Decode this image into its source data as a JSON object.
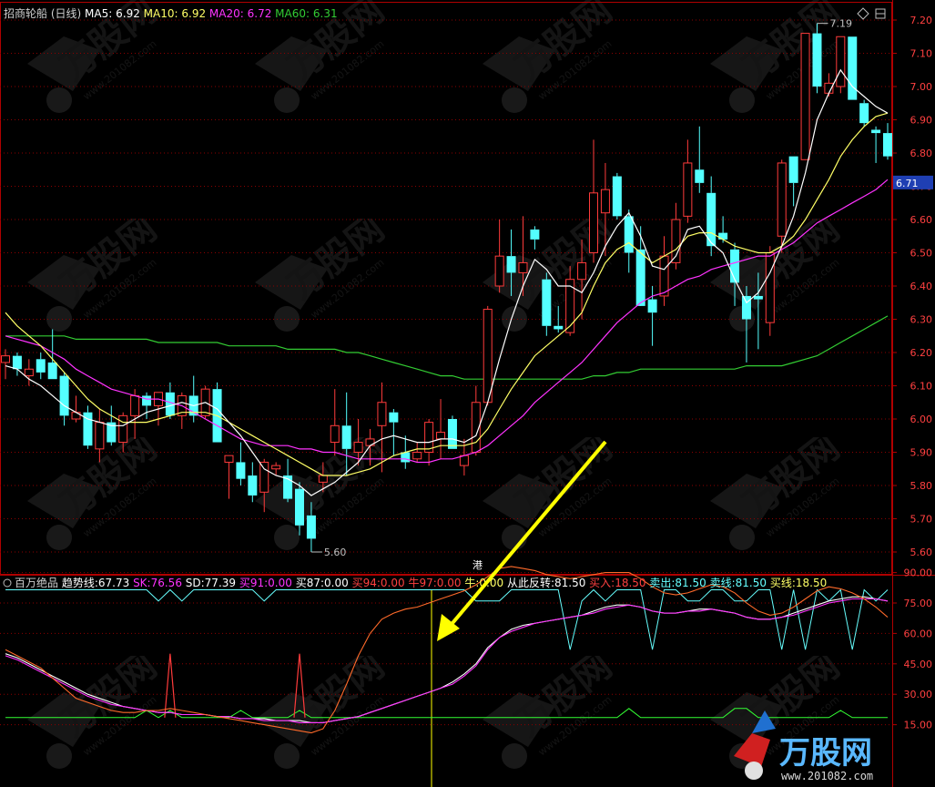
{
  "colors": {
    "bg": "#000000",
    "grid": "#8b0000",
    "frame": "#b00000",
    "up": "#ff3b3b",
    "down": "#54ffff",
    "ma5": "#ffffff",
    "ma10": "#ffff66",
    "ma20": "#ff33ff",
    "ma60": "#33cc33",
    "axis_text": "#ff4040",
    "annotation": "#c0c0c0",
    "arrow": "#ffff00",
    "cursor": "#ffff00",
    "ind_trend": "#ffffff",
    "ind_sk": "#ff33ff",
    "ind_sd": "#ff6a2a",
    "ind_line1": "#66ffff",
    "ind_line2": "#33ff33"
  },
  "header": {
    "stock": "招商轮船",
    "period": "(日线)",
    "ma": [
      {
        "label": "MA5:",
        "value": "6.92",
        "color": "#ffffff"
      },
      {
        "label": "MA10:",
        "value": "6.92",
        "color": "#ffff66"
      },
      {
        "label": "MA20:",
        "value": "6.72",
        "color": "#ff33ff"
      },
      {
        "label": "MA60:",
        "value": "6.31",
        "color": "#33cc33"
      }
    ]
  },
  "price_axis": [
    "7.20",
    "7.10",
    "7.00",
    "6.90",
    "6.80",
    "6.70",
    "6.60",
    "6.50",
    "6.40",
    "6.30",
    "6.20",
    "6.10",
    "6.00",
    "5.90",
    "5.80",
    "5.70",
    "5.60"
  ],
  "current_price_tag": "6.71",
  "annotations": {
    "high": "7.19",
    "low": "5.60",
    "event_marker": "港"
  },
  "indicator": {
    "name": "百万绝品",
    "items": [
      {
        "label": "趋势线:",
        "value": "67.73",
        "color": "#ffffff"
      },
      {
        "label": "SK:",
        "value": "76.56",
        "color": "#ff33ff"
      },
      {
        "label": "SD:",
        "value": "77.39",
        "color": "#ffffff"
      },
      {
        "label": "买91:",
        "value": "0.00",
        "color": "#ff33ff"
      },
      {
        "label": "买87:",
        "value": "0.00",
        "color": "#ffffff"
      },
      {
        "label": "买94:",
        "value": "0.00",
        "color": "#ff4040"
      },
      {
        "label": "牛97:",
        "value": "0.00",
        "color": "#ff4040"
      },
      {
        "label": "牛:",
        "value": "0.00",
        "color": "#ffff66"
      },
      {
        "label": "从此反转:",
        "value": "81.50",
        "color": "#ffffff"
      },
      {
        "label": "买入:",
        "value": "18.50",
        "color": "#ff4040"
      },
      {
        "label": "卖出:",
        "value": "81.50",
        "color": "#66ffff"
      },
      {
        "label": "卖线:",
        "value": "81.50",
        "color": "#66ffff"
      },
      {
        "label": "买线:",
        "value": "18.50",
        "color": "#ffff66"
      }
    ],
    "axis": [
      "90.00",
      "75.00",
      "60.00",
      "45.00",
      "30.00",
      "15.00"
    ]
  },
  "watermark": {
    "logo_text": "万股网",
    "site": "www.201082.com"
  },
  "chart_data": [
    {
      "type": "candlestick",
      "title": "招商轮船 (日线)",
      "ylim": [
        5.55,
        7.24
      ],
      "series_names": [
        "MA5",
        "MA10",
        "MA20",
        "MA60"
      ],
      "candles": [
        {
          "o": 6.17,
          "h": 6.21,
          "l": 6.12,
          "c": 6.19
        },
        {
          "o": 6.19,
          "h": 6.2,
          "l": 6.13,
          "c": 6.15
        },
        {
          "o": 6.13,
          "h": 6.18,
          "l": 6.1,
          "c": 6.15
        },
        {
          "o": 6.18,
          "h": 6.2,
          "l": 6.12,
          "c": 6.14
        },
        {
          "o": 6.17,
          "h": 6.27,
          "l": 6.12,
          "c": 6.12
        },
        {
          "o": 6.13,
          "h": 6.14,
          "l": 5.98,
          "c": 6.01
        },
        {
          "o": 6.0,
          "h": 6.07,
          "l": 5.99,
          "c": 6.02
        },
        {
          "o": 6.02,
          "h": 6.04,
          "l": 5.91,
          "c": 5.92
        },
        {
          "o": 5.91,
          "h": 6.03,
          "l": 5.87,
          "c": 5.99
        },
        {
          "o": 5.99,
          "h": 6.04,
          "l": 5.92,
          "c": 5.93
        },
        {
          "o": 5.93,
          "h": 6.02,
          "l": 5.9,
          "c": 6.01
        },
        {
          "o": 6.01,
          "h": 6.09,
          "l": 5.94,
          "c": 6.07
        },
        {
          "o": 6.07,
          "h": 6.08,
          "l": 6.0,
          "c": 6.04
        },
        {
          "o": 6.04,
          "h": 6.08,
          "l": 5.98,
          "c": 6.08
        },
        {
          "o": 6.08,
          "h": 6.11,
          "l": 6.0,
          "c": 6.01
        },
        {
          "o": 6.01,
          "h": 6.08,
          "l": 5.97,
          "c": 6.07
        },
        {
          "o": 6.07,
          "h": 6.13,
          "l": 5.99,
          "c": 6.01
        },
        {
          "o": 6.01,
          "h": 6.1,
          "l": 6.0,
          "c": 6.09
        },
        {
          "o": 6.09,
          "h": 6.11,
          "l": 5.93,
          "c": 5.93
        },
        {
          "o": 5.87,
          "h": 5.89,
          "l": 5.76,
          "c": 5.89
        },
        {
          "o": 5.87,
          "h": 5.93,
          "l": 5.8,
          "c": 5.82
        },
        {
          "o": 5.83,
          "h": 5.87,
          "l": 5.75,
          "c": 5.77
        },
        {
          "o": 5.78,
          "h": 5.88,
          "l": 5.72,
          "c": 5.87
        },
        {
          "o": 5.85,
          "h": 5.87,
          "l": 5.83,
          "c": 5.86
        },
        {
          "o": 5.83,
          "h": 5.88,
          "l": 5.75,
          "c": 5.76
        },
        {
          "o": 5.79,
          "h": 5.81,
          "l": 5.65,
          "c": 5.68
        },
        {
          "o": 5.71,
          "h": 5.75,
          "l": 5.6,
          "c": 5.64
        },
        {
          "o": 5.81,
          "h": 5.87,
          "l": 5.78,
          "c": 5.83
        },
        {
          "o": 5.93,
          "h": 6.09,
          "l": 5.89,
          "c": 5.98
        },
        {
          "o": 5.98,
          "h": 6.08,
          "l": 5.83,
          "c": 5.91
        },
        {
          "o": 5.9,
          "h": 6.0,
          "l": 5.86,
          "c": 5.93
        },
        {
          "o": 5.92,
          "h": 5.97,
          "l": 5.86,
          "c": 5.94
        },
        {
          "o": 5.98,
          "h": 6.11,
          "l": 5.84,
          "c": 6.05
        },
        {
          "o": 6.02,
          "h": 6.03,
          "l": 5.89,
          "c": 5.99
        },
        {
          "o": 5.9,
          "h": 5.95,
          "l": 5.85,
          "c": 5.87
        },
        {
          "o": 5.88,
          "h": 5.93,
          "l": 5.87,
          "c": 5.9
        },
        {
          "o": 5.9,
          "h": 6.0,
          "l": 5.86,
          "c": 5.99
        },
        {
          "o": 5.94,
          "h": 6.06,
          "l": 5.88,
          "c": 5.96
        },
        {
          "o": 6.0,
          "h": 6.01,
          "l": 5.91,
          "c": 5.91
        },
        {
          "o": 5.86,
          "h": 5.94,
          "l": 5.83,
          "c": 5.89
        },
        {
          "o": 5.9,
          "h": 6.1,
          "l": 5.89,
          "c": 6.05
        },
        {
          "o": 6.05,
          "h": 6.34,
          "l": 6.04,
          "c": 6.33
        },
        {
          "o": 6.4,
          "h": 6.6,
          "l": 6.38,
          "c": 6.49
        },
        {
          "o": 6.49,
          "h": 6.57,
          "l": 6.37,
          "c": 6.44
        },
        {
          "o": 6.44,
          "h": 6.61,
          "l": 6.37,
          "c": 6.47
        },
        {
          "o": 6.57,
          "h": 6.58,
          "l": 6.51,
          "c": 6.54
        },
        {
          "o": 6.42,
          "h": 6.44,
          "l": 6.25,
          "c": 6.28
        },
        {
          "o": 6.28,
          "h": 6.34,
          "l": 6.26,
          "c": 6.27
        },
        {
          "o": 6.26,
          "h": 6.46,
          "l": 6.25,
          "c": 6.42
        },
        {
          "o": 6.42,
          "h": 6.54,
          "l": 6.3,
          "c": 6.47
        },
        {
          "o": 6.5,
          "h": 6.84,
          "l": 6.47,
          "c": 6.68
        },
        {
          "o": 6.62,
          "h": 6.77,
          "l": 6.49,
          "c": 6.69
        },
        {
          "o": 6.73,
          "h": 6.74,
          "l": 6.6,
          "c": 6.61
        },
        {
          "o": 6.61,
          "h": 6.63,
          "l": 6.44,
          "c": 6.5
        },
        {
          "o": 6.51,
          "h": 6.58,
          "l": 6.35,
          "c": 6.34
        },
        {
          "o": 6.36,
          "h": 6.4,
          "l": 6.22,
          "c": 6.32
        },
        {
          "o": 6.37,
          "h": 6.55,
          "l": 6.34,
          "c": 6.49
        },
        {
          "o": 6.47,
          "h": 6.65,
          "l": 6.45,
          "c": 6.6
        },
        {
          "o": 6.61,
          "h": 6.84,
          "l": 6.59,
          "c": 6.77
        },
        {
          "o": 6.75,
          "h": 6.88,
          "l": 6.68,
          "c": 6.71
        },
        {
          "o": 6.68,
          "h": 6.73,
          "l": 6.49,
          "c": 6.52
        },
        {
          "o": 6.56,
          "h": 6.61,
          "l": 6.53,
          "c": 6.54
        },
        {
          "o": 6.51,
          "h": 6.53,
          "l": 6.34,
          "c": 6.41
        },
        {
          "o": 6.37,
          "h": 6.4,
          "l": 6.17,
          "c": 6.3
        },
        {
          "o": 6.37,
          "h": 6.44,
          "l": 6.21,
          "c": 6.36
        },
        {
          "o": 6.29,
          "h": 6.52,
          "l": 6.25,
          "c": 6.5
        },
        {
          "o": 6.55,
          "h": 6.78,
          "l": 6.5,
          "c": 6.77
        },
        {
          "o": 6.79,
          "h": 6.79,
          "l": 6.64,
          "c": 6.71
        },
        {
          "o": 6.78,
          "h": 7.11,
          "l": 6.78,
          "c": 7.16
        },
        {
          "o": 7.16,
          "h": 7.19,
          "l": 6.98,
          "c": 7.0
        },
        {
          "o": 6.98,
          "h": 7.04,
          "l": 6.97,
          "c": 7.01
        },
        {
          "o": 7.0,
          "h": 7.15,
          "l": 6.98,
          "c": 7.15
        },
        {
          "o": 7.15,
          "h": 7.15,
          "l": 6.96,
          "c": 6.96
        },
        {
          "o": 6.95,
          "h": 6.96,
          "l": 6.88,
          "c": 6.89
        },
        {
          "o": 6.87,
          "h": 6.88,
          "l": 6.77,
          "c": 6.86
        },
        {
          "o": 6.86,
          "h": 6.89,
          "l": 6.78,
          "c": 6.79
        }
      ],
      "ma5": [
        6.16,
        6.15,
        6.12,
        6.1,
        6.07,
        6.04,
        6.02,
        6.0,
        5.99,
        5.98,
        5.98,
        6.0,
        6.02,
        6.03,
        6.04,
        6.05,
        6.04,
        6.05,
        6.03,
        5.99,
        5.95,
        5.9,
        5.85,
        5.83,
        5.82,
        5.8,
        5.77,
        5.79,
        5.81,
        5.84,
        5.87,
        5.92,
        5.94,
        5.95,
        5.94,
        5.93,
        5.93,
        5.94,
        5.94,
        5.93,
        5.95,
        6.05,
        6.18,
        6.3,
        6.4,
        6.48,
        6.45,
        6.4,
        6.4,
        6.38,
        6.44,
        6.52,
        6.58,
        6.62,
        6.55,
        6.46,
        6.45,
        6.49,
        6.57,
        6.58,
        6.53,
        6.5,
        6.42,
        6.35,
        6.38,
        6.44,
        6.52,
        6.61,
        6.74,
        6.9,
        6.98,
        7.05,
        7.0,
        6.97,
        6.94,
        6.92
      ],
      "ma10": [
        6.32,
        6.28,
        6.25,
        6.22,
        6.18,
        6.14,
        6.1,
        6.06,
        6.03,
        6.01,
        5.99,
        5.99,
        5.99,
        6.0,
        6.01,
        6.02,
        6.02,
        6.02,
        6.01,
        5.99,
        5.97,
        5.95,
        5.93,
        5.91,
        5.89,
        5.87,
        5.85,
        5.83,
        5.83,
        5.83,
        5.84,
        5.85,
        5.87,
        5.89,
        5.9,
        5.91,
        5.91,
        5.92,
        5.92,
        5.92,
        5.93,
        5.97,
        6.03,
        6.09,
        6.14,
        6.19,
        6.22,
        6.25,
        6.28,
        6.32,
        6.4,
        6.47,
        6.51,
        6.53,
        6.5,
        6.47,
        6.49,
        6.51,
        6.55,
        6.56,
        6.56,
        6.54,
        6.52,
        6.51,
        6.5,
        6.5,
        6.52,
        6.55,
        6.6,
        6.66,
        6.72,
        6.79,
        6.84,
        6.88,
        6.91,
        6.92
      ],
      "ma20": [
        6.25,
        6.24,
        6.23,
        6.22,
        6.2,
        6.18,
        6.15,
        6.13,
        6.11,
        6.09,
        6.08,
        6.07,
        6.06,
        6.06,
        6.05,
        6.04,
        6.02,
        6.0,
        5.98,
        5.96,
        5.94,
        5.93,
        5.92,
        5.92,
        5.92,
        5.91,
        5.91,
        5.9,
        5.9,
        5.89,
        5.88,
        5.88,
        5.88,
        5.88,
        5.88,
        5.87,
        5.87,
        5.88,
        5.88,
        5.89,
        5.9,
        5.92,
        5.95,
        5.98,
        6.01,
        6.05,
        6.08,
        6.11,
        6.14,
        6.17,
        6.21,
        6.25,
        6.29,
        6.32,
        6.35,
        6.37,
        6.38,
        6.4,
        6.42,
        6.43,
        6.45,
        6.46,
        6.47,
        6.48,
        6.49,
        6.49,
        6.51,
        6.53,
        6.56,
        6.59,
        6.61,
        6.63,
        6.65,
        6.67,
        6.69,
        6.72
      ],
      "ma60": [
        6.25,
        6.25,
        6.25,
        6.25,
        6.25,
        6.25,
        6.24,
        6.24,
        6.24,
        6.24,
        6.24,
        6.24,
        6.24,
        6.23,
        6.23,
        6.23,
        6.23,
        6.23,
        6.23,
        6.22,
        6.22,
        6.22,
        6.22,
        6.22,
        6.21,
        6.21,
        6.21,
        6.21,
        6.21,
        6.2,
        6.2,
        6.19,
        6.18,
        6.17,
        6.16,
        6.15,
        6.14,
        6.13,
        6.13,
        6.12,
        6.12,
        6.12,
        6.12,
        6.12,
        6.12,
        6.12,
        6.12,
        6.12,
        6.12,
        6.12,
        6.13,
        6.13,
        6.14,
        6.14,
        6.15,
        6.15,
        6.15,
        6.15,
        6.15,
        6.15,
        6.15,
        6.15,
        6.15,
        6.16,
        6.16,
        6.16,
        6.16,
        6.17,
        6.18,
        6.19,
        6.21,
        6.23,
        6.25,
        6.27,
        6.29,
        6.31
      ]
    },
    {
      "type": "line",
      "title": "百万绝品",
      "ylim": [
        0,
        100
      ],
      "series": [
        {
          "name": "趋势线",
          "values": [
            50,
            48,
            45,
            42,
            39,
            36,
            33,
            30,
            28,
            26,
            24,
            23,
            22,
            21,
            21,
            20,
            20,
            20,
            19,
            19,
            18,
            18,
            18,
            17,
            17,
            17,
            16,
            16,
            17,
            18,
            19,
            21,
            23,
            25,
            27,
            29,
            31,
            33,
            36,
            40,
            45,
            53,
            58,
            62,
            64,
            65,
            66,
            67,
            68,
            69,
            71,
            73,
            74,
            74,
            73,
            71,
            70,
            70,
            71,
            72,
            72,
            71,
            70,
            68,
            67,
            67,
            68,
            70,
            72,
            74,
            76,
            77,
            78,
            78,
            77,
            76
          ]
        },
        {
          "name": "SK",
          "values": [
            49,
            47,
            44,
            41,
            38,
            35,
            32,
            29,
            27,
            25,
            24,
            23,
            22,
            21,
            21,
            20,
            20,
            20,
            19,
            19,
            18,
            18,
            17,
            17,
            17,
            16,
            16,
            16,
            17,
            18,
            19,
            21,
            23,
            25,
            27,
            29,
            31,
            33,
            35,
            39,
            44,
            52,
            58,
            61,
            63,
            65,
            66,
            67,
            68,
            69,
            70,
            72,
            73,
            74,
            73,
            71,
            70,
            70,
            71,
            71,
            72,
            71,
            70,
            68,
            67,
            67,
            68,
            69,
            71,
            73,
            75,
            76,
            77,
            77,
            77,
            76
          ]
        },
        {
          "name": "SD",
          "values": [
            52,
            49,
            46,
            43,
            38,
            33,
            28,
            26,
            24,
            22,
            21,
            21,
            22,
            22,
            23,
            22,
            21,
            20,
            19,
            18,
            17,
            16,
            15,
            14,
            13,
            12,
            11,
            13,
            22,
            35,
            49,
            60,
            67,
            70,
            72,
            73,
            75,
            77,
            79,
            81,
            84,
            88,
            92,
            93,
            92,
            91,
            89,
            88,
            87,
            88,
            89,
            90,
            90,
            90,
            87,
            83,
            80,
            79,
            80,
            82,
            84,
            83,
            80,
            75,
            71,
            69,
            70,
            73,
            77,
            81,
            83,
            82,
            80,
            77,
            73,
            68
          ]
        }
      ],
      "reference_lines": {
        "从此反转": 81.5,
        "买入": 18.5
      }
    }
  ]
}
